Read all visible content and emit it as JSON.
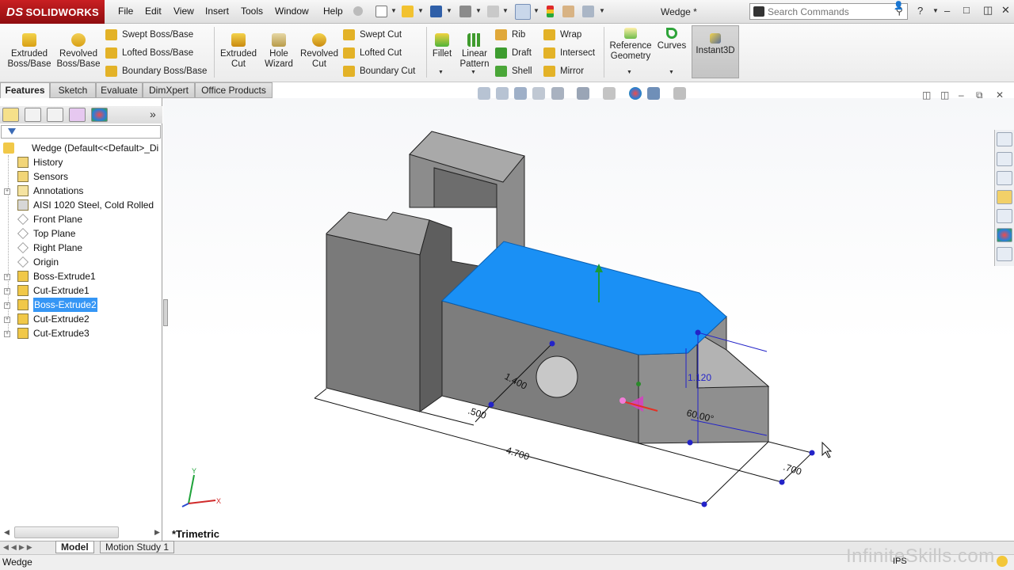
{
  "app": {
    "logo": "SOLIDWORKS",
    "doc_title": "Wedge *"
  },
  "menu": [
    "File",
    "Edit",
    "View",
    "Insert",
    "Tools",
    "Window",
    "Help"
  ],
  "search": {
    "placeholder": "Search Commands"
  },
  "commands": {
    "extruded_boss": "Extruded Boss/Base",
    "revolved_boss": "Revolved Boss/Base",
    "swept_boss": "Swept Boss/Base",
    "lofted_boss": "Lofted Boss/Base",
    "boundary_boss": "Boundary Boss/Base",
    "extruded_cut": "Extruded Cut",
    "hole_wizard": "Hole Wizard",
    "revolved_cut": "Revolved Cut",
    "swept_cut": "Swept Cut",
    "lofted_cut": "Lofted Cut",
    "boundary_cut": "Boundary Cut",
    "fillet": "Fillet",
    "linear_pattern": "Linear Pattern",
    "rib": "Rib",
    "draft": "Draft",
    "shell": "Shell",
    "wrap": "Wrap",
    "intersect": "Intersect",
    "mirror": "Mirror",
    "reference_geometry": "Reference Geometry",
    "curves": "Curves",
    "instant3d": "Instant3D"
  },
  "cm_tabs": [
    "Features",
    "Sketch",
    "Evaluate",
    "DimXpert",
    "Office Products"
  ],
  "tree": {
    "root": "Wedge  (Default<<Default>_Di",
    "items": [
      {
        "label": "History",
        "icon": "history-icon"
      },
      {
        "label": "Sensors",
        "icon": "sensors-icon"
      },
      {
        "label": "Annotations",
        "icon": "annotations-icon"
      },
      {
        "label": "AISI 1020 Steel, Cold Rolled",
        "icon": "material-icon"
      },
      {
        "label": "Front Plane",
        "icon": "plane-icon"
      },
      {
        "label": "Top Plane",
        "icon": "plane-icon"
      },
      {
        "label": "Right Plane",
        "icon": "plane-icon"
      },
      {
        "label": "Origin",
        "icon": "origin-icon"
      },
      {
        "label": "Boss-Extrude1",
        "icon": "feature-icon"
      },
      {
        "label": "Cut-Extrude1",
        "icon": "feature-icon"
      },
      {
        "label": "Boss-Extrude2",
        "icon": "feature-icon",
        "selected": true
      },
      {
        "label": "Cut-Extrude2",
        "icon": "feature-icon"
      },
      {
        "label": "Cut-Extrude3",
        "icon": "feature-icon"
      }
    ]
  },
  "model": {
    "dimensions": [
      "1.400",
      ".500",
      "4.700",
      "1.120",
      "60.00°",
      ".700"
    ],
    "view_name": "*Trimetric",
    "triad": {
      "x": "X",
      "y": "Y"
    },
    "selected_face_color": "#1a90f5",
    "body_color": "#7d7d7d"
  },
  "bottom_tabs": [
    "Model",
    "Motion Study 1"
  ],
  "status": {
    "text": "Wedge",
    "units": "IPS"
  },
  "watermark": "InfiniteSkills.com"
}
